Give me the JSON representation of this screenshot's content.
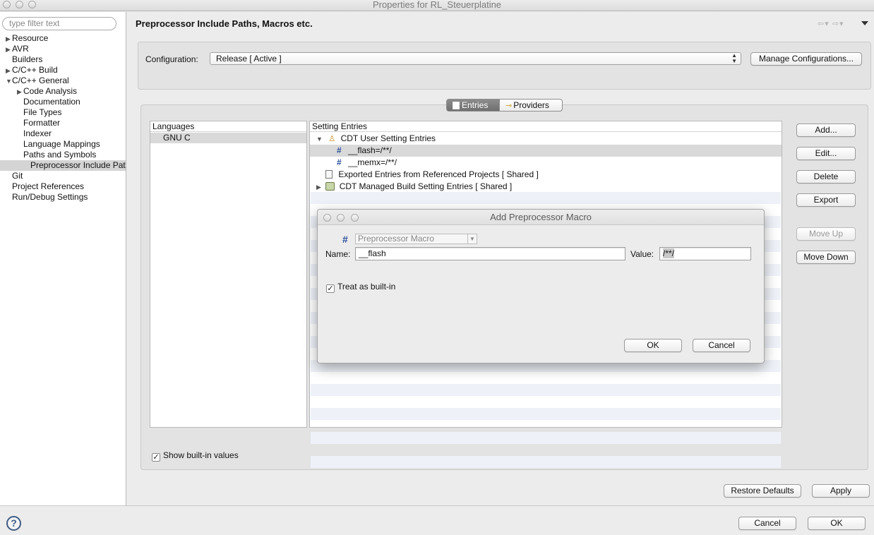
{
  "window": {
    "title": "Properties for RL_Steuerplatine"
  },
  "sidebar": {
    "filter_placeholder": "type filter text",
    "items": [
      {
        "label": "Resource",
        "indent": 0,
        "toggle": "collapsed"
      },
      {
        "label": "AVR",
        "indent": 0,
        "toggle": "collapsed"
      },
      {
        "label": "Builders",
        "indent": 0,
        "toggle": "none"
      },
      {
        "label": "C/C++ Build",
        "indent": 0,
        "toggle": "collapsed"
      },
      {
        "label": "C/C++ General",
        "indent": 0,
        "toggle": "expanded"
      },
      {
        "label": "Code Analysis",
        "indent": 1,
        "toggle": "collapsed"
      },
      {
        "label": "Documentation",
        "indent": 1,
        "toggle": "none"
      },
      {
        "label": "File Types",
        "indent": 1,
        "toggle": "none"
      },
      {
        "label": "Formatter",
        "indent": 1,
        "toggle": "none"
      },
      {
        "label": "Indexer",
        "indent": 1,
        "toggle": "none"
      },
      {
        "label": "Language Mappings",
        "indent": 1,
        "toggle": "none"
      },
      {
        "label": "Paths and Symbols",
        "indent": 1,
        "toggle": "none"
      },
      {
        "label": "Preprocessor Include Pat",
        "indent": 1,
        "toggle": "none",
        "selected": true
      },
      {
        "label": "Git",
        "indent": 0,
        "toggle": "none"
      },
      {
        "label": "Project References",
        "indent": 0,
        "toggle": "none"
      },
      {
        "label": "Run/Debug Settings",
        "indent": 0,
        "toggle": "none"
      }
    ]
  },
  "header": {
    "title": "Preprocessor Include Paths, Macros etc.",
    "nav_back": "⇦▾",
    "nav_forward": "⇨▾"
  },
  "configuration": {
    "label": "Configuration:",
    "value": "Release  [ Active ]",
    "manage_button": "Manage Configurations..."
  },
  "tabs": {
    "entries": "Entries",
    "providers": "Providers"
  },
  "languages": {
    "header": "Languages",
    "items": [
      "GNU C"
    ]
  },
  "setting_entries": {
    "header": "Setting Entries",
    "rows": [
      {
        "label": "CDT User Setting Entries",
        "level": 0
      },
      {
        "label": "__flash=/**/",
        "level": 1
      },
      {
        "label": "__memx=/**/",
        "level": 1
      },
      {
        "label": "Exported Entries from Referenced Projects   [ Shared ]",
        "level": 0
      },
      {
        "label": "CDT Managed Build Setting Entries   [ Shared ]",
        "level": 0
      }
    ]
  },
  "side_buttons": {
    "add": "Add...",
    "edit": "Edit...",
    "delete": "Delete",
    "export": "Export",
    "move_up": "Move Up",
    "move_down": "Move Down"
  },
  "show_builtin": {
    "label": "Show built-in values",
    "checked": true
  },
  "footer": {
    "restore": "Restore Defaults",
    "apply": "Apply",
    "cancel": "Cancel",
    "ok": "OK",
    "help": "?"
  },
  "dialog": {
    "title": "Add Preprocessor Macro",
    "kind_hash": "#",
    "kind_select": "Preprocessor Macro",
    "name_label": "Name:",
    "name_value": "__flash",
    "value_label": "Value:",
    "value_value": "/**/",
    "treat_builtin": "Treat as built-in",
    "treat_checked": true,
    "ok": "OK",
    "cancel": "Cancel"
  },
  "colors": {
    "selection": "#d4d4d4",
    "stripe": "#eef2f8",
    "macro_icon": "#2a4f9a"
  }
}
